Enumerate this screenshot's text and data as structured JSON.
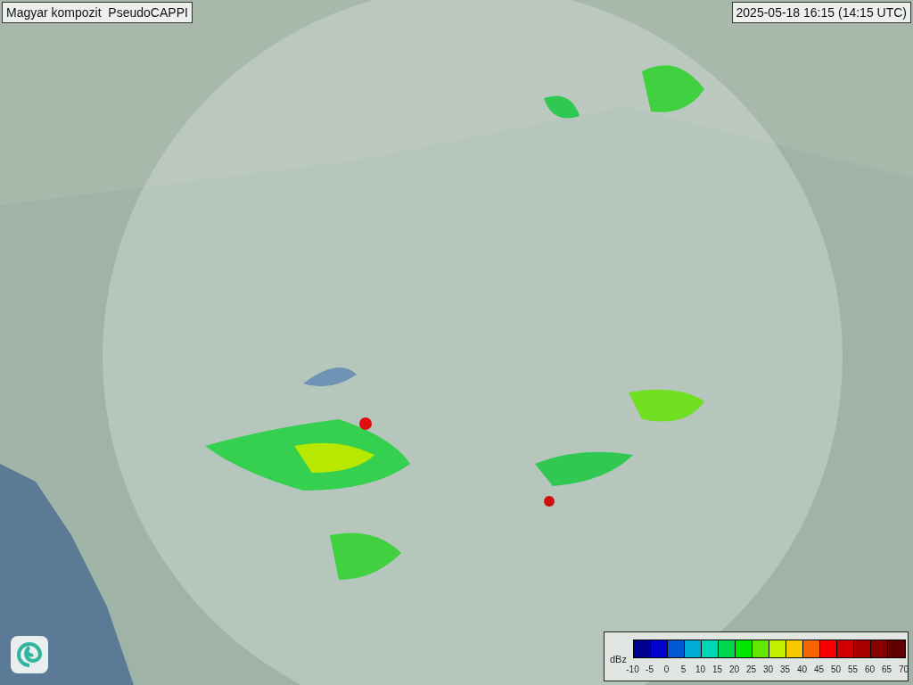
{
  "title": "Magyar kompozit  PseudoCAPPI",
  "timestamp": "2025-05-18 16:15 (14:15 UTC)",
  "legend": {
    "unit": "dBz",
    "bins": [
      {
        "color": "#000090"
      },
      {
        "color": "#0000d0"
      },
      {
        "color": "#0058d0"
      },
      {
        "color": "#00acd8"
      },
      {
        "color": "#00d8b4"
      },
      {
        "color": "#00d850"
      },
      {
        "color": "#00e800"
      },
      {
        "color": "#60e800"
      },
      {
        "color": "#c4f000"
      },
      {
        "color": "#f8c800"
      },
      {
        "color": "#f86400"
      },
      {
        "color": "#f80000"
      },
      {
        "color": "#d00000"
      },
      {
        "color": "#a80000"
      },
      {
        "color": "#880000"
      },
      {
        "color": "#600000"
      }
    ],
    "ticks": [
      "-10",
      "-5",
      "0",
      "5",
      "10",
      "15",
      "20",
      "25",
      "30",
      "35",
      "40",
      "45",
      "50",
      "55",
      "60",
      "65",
      "70"
    ]
  }
}
